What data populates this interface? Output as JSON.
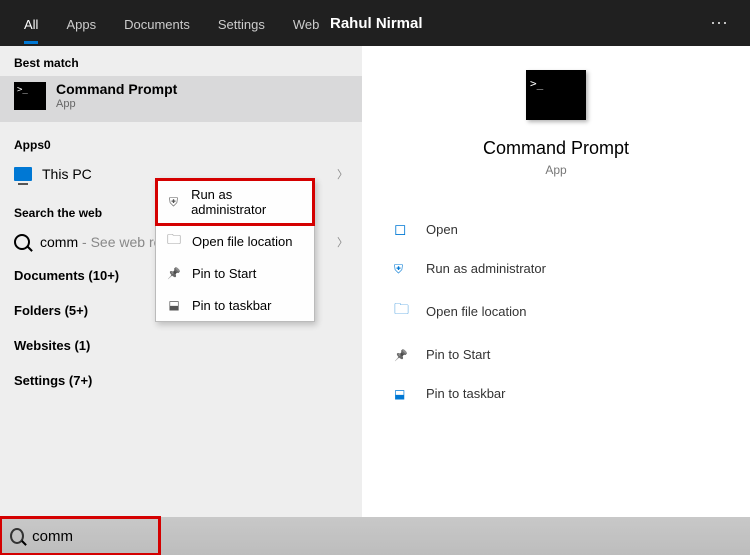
{
  "tabs": {
    "all": "All",
    "apps": "Apps",
    "documents": "Documents",
    "settings": "Settings",
    "web": "Web"
  },
  "user_name": "Rahul Nirmal",
  "left": {
    "best_match_heading": "Best match",
    "best_match": {
      "title_prefix_bold": "Comm",
      "title_rest": "and Prompt",
      "subtitle": "App"
    },
    "apps_heading": "Apps0",
    "this_pc": "This PC",
    "search_web_heading": "Search the web",
    "web_result_prefix": "comm",
    "web_result_suffix": " - See web results",
    "categories": {
      "documents": "Documents (10+)",
      "folders": "Folders (5+)",
      "websites": "Websites (1)",
      "settings": "Settings (7+)"
    }
  },
  "context_menu": {
    "run_admin": "Run as administrator",
    "open_loc": "Open file location",
    "pin_start": "Pin to Start",
    "pin_taskbar": "Pin to taskbar"
  },
  "right": {
    "title": "Command Prompt",
    "subtitle": "App",
    "actions": {
      "open": "Open",
      "run_admin": "Run as administrator",
      "open_loc": "Open file location",
      "pin_start": "Pin to Start",
      "pin_taskbar": "Pin to taskbar"
    }
  },
  "search": {
    "value": "comm"
  }
}
